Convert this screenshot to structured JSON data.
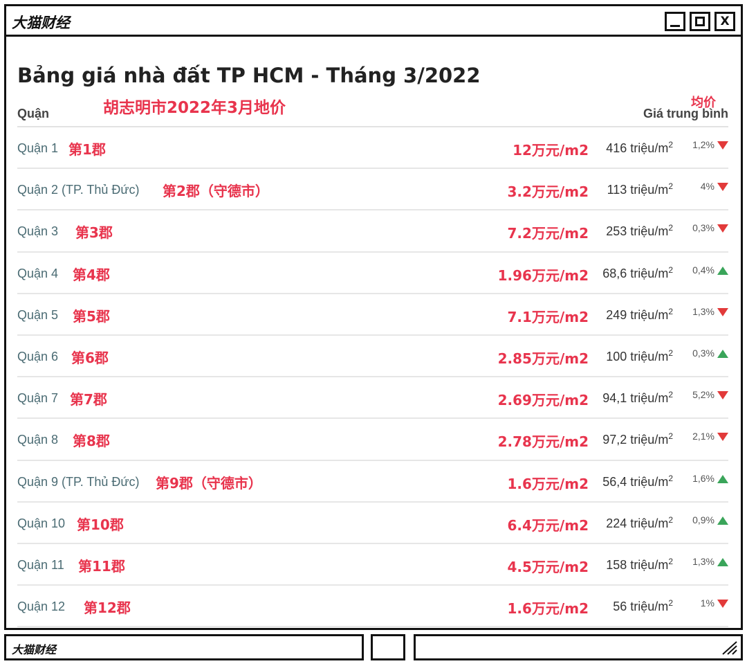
{
  "window": {
    "title": "大猫财经",
    "minimize_icon": "minimize-icon",
    "maximize_icon": "maximize-icon",
    "close_label": "X"
  },
  "page": {
    "heading": "Bảng giá nhà đất TP HCM - Tháng 3/2022",
    "subheading_zh": "胡志明市2022年3月地价",
    "avg_zh": "均价",
    "col_left": "Quận",
    "col_right": "Giá trung bình"
  },
  "colors": {
    "accent_red": "#e8344d",
    "down_red": "#e23a3a",
    "up_green": "#3aa55a",
    "district_teal": "#4a6b73"
  },
  "rows": [
    {
      "district": "Quận 1",
      "district_zh": "第1郡",
      "cny": "12万元/m2",
      "vnd": "416 triệu/m",
      "unit_sup": "2",
      "pct": "1,2%",
      "trend": "down"
    },
    {
      "district": "Quận 2 (TP. Thủ Đức)",
      "district_zh": "第2郡（守德市）",
      "cny": "3.2万元/m2",
      "vnd": "113 triệu/m",
      "unit_sup": "2",
      "pct": "4%",
      "trend": "down"
    },
    {
      "district": "Quận 3",
      "district_zh": "第3郡",
      "cny": "7.2万元/m2",
      "vnd": "253 triệu/m",
      "unit_sup": "2",
      "pct": "0,3%",
      "trend": "down"
    },
    {
      "district": "Quận 4",
      "district_zh": "第4郡",
      "cny": "1.96万元/m2",
      "vnd": "68,6 triệu/m",
      "unit_sup": "2",
      "pct": "0,4%",
      "trend": "up"
    },
    {
      "district": "Quận 5",
      "district_zh": "第5郡",
      "cny": "7.1万元/m2",
      "vnd": "249 triệu/m",
      "unit_sup": "2",
      "pct": "1,3%",
      "trend": "down"
    },
    {
      "district": "Quận 6",
      "district_zh": "第6郡",
      "cny": "2.85万元/m2",
      "vnd": "100 triệu/m",
      "unit_sup": "2",
      "pct": "0,3%",
      "trend": "up"
    },
    {
      "district": "Quận 7",
      "district_zh": "第7郡",
      "cny": "2.69万元/m2",
      "vnd": "94,1 triệu/m",
      "unit_sup": "2",
      "pct": "5,2%",
      "trend": "down"
    },
    {
      "district": "Quận 8",
      "district_zh": "第8郡",
      "cny": "2.78万元/m2",
      "vnd": "97,2 triệu/m",
      "unit_sup": "2",
      "pct": "2,1%",
      "trend": "down"
    },
    {
      "district": "Quận 9 (TP. Thủ Đức)",
      "district_zh": "第9郡（守德市）",
      "cny": "1.6万元/m2",
      "vnd": "56,4 triệu/m",
      "unit_sup": "2",
      "pct": "1,6%",
      "trend": "up"
    },
    {
      "district": "Quận 10",
      "district_zh": "第10郡",
      "cny": "6.4万元/m2",
      "vnd": "224 triệu/m",
      "unit_sup": "2",
      "pct": "0,9%",
      "trend": "up"
    },
    {
      "district": "Quận 11",
      "district_zh": "第11郡",
      "cny": "4.5万元/m2",
      "vnd": "158 triệu/m",
      "unit_sup": "2",
      "pct": "1,3%",
      "trend": "up"
    },
    {
      "district": "Quận 12",
      "district_zh": "第12郡",
      "cny": "1.6万元/m2",
      "vnd": "56 triệu/m",
      "unit_sup": "2",
      "pct": "1%",
      "trend": "down"
    }
  ],
  "statusbar": {
    "label": "大猫财经",
    "grip_icon": "resize-grip-icon"
  }
}
